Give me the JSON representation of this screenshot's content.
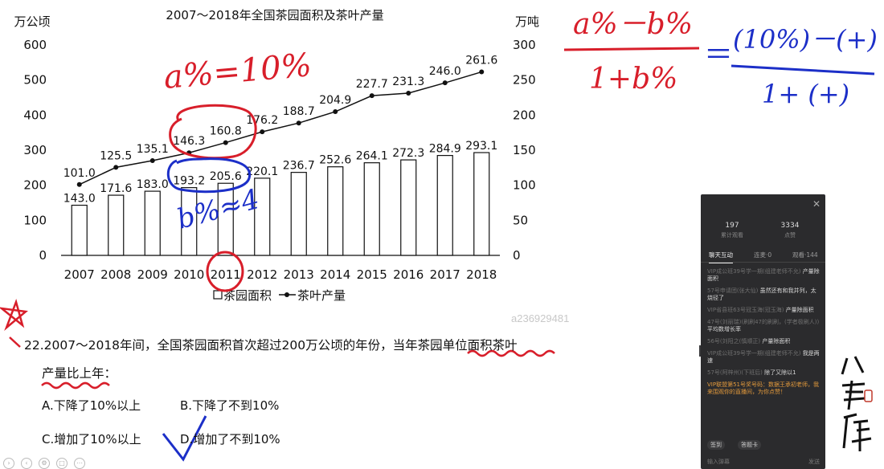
{
  "chart_data": {
    "type": "bar+line",
    "title": "2007～2018年全国茶园面积及茶叶产量",
    "ylabel_left": "万公顷",
    "ylabel_right": "万吨",
    "categories": [
      "2007",
      "2008",
      "2009",
      "2010",
      "2011",
      "2012",
      "2013",
      "2014",
      "2015",
      "2016",
      "2017",
      "2018"
    ],
    "series": [
      {
        "name": "茶园面积",
        "kind": "bar",
        "axis": "left",
        "values": [
          143.0,
          171.6,
          183.0,
          193.2,
          205.6,
          220.1,
          236.7,
          252.6,
          264.1,
          272.3,
          284.9,
          293.1
        ],
        "labels": [
          "143.0",
          "171.6",
          "183.0",
          "193.2",
          "205.6",
          "220.1",
          "236.7",
          "252.6",
          "264.1",
          "272.3",
          "284.9",
          "293.1"
        ]
      },
      {
        "name": "茶叶产量",
        "kind": "line",
        "axis": "right",
        "values": [
          101.0,
          125.5,
          135.1,
          146.3,
          160.8,
          176.2,
          188.7,
          204.9,
          227.7,
          231.3,
          246.0,
          261.6
        ],
        "labels": [
          "101.0",
          "125.5",
          "135.1",
          "146.3",
          "160.8",
          "176.2",
          "188.7",
          "204.9",
          "227.7",
          "231.3",
          "246.0",
          "261.6"
        ]
      }
    ],
    "ylim_left": [
      0,
      600
    ],
    "yticks_left": [
      "0",
      "100",
      "200",
      "300",
      "400",
      "500",
      "600"
    ],
    "ylim_right": [
      0,
      300
    ],
    "yticks_right": [
      "0",
      "50",
      "100",
      "150",
      "200",
      "250",
      "300"
    ],
    "legend": [
      "茶园面积",
      "茶叶产量"
    ],
    "legend_position": "bottom",
    "grid": false
  },
  "annotations": {
    "a_eq": "a%=10%",
    "b_eq": "b%≈4",
    "formula_top": "a%－b%",
    "formula_bottom": "1+b%",
    "formula_eq": "＝",
    "formula_right_top": "(10%)－(+)",
    "formula_right_bottom": "1+ (+)",
    "pen_color_red": "#d81e2a",
    "pen_color_blue": "#1c2fc8"
  },
  "question": {
    "stem_part1": "22.2007～2018年间，全国茶园面积首次超过200万公顷的年份，当年茶园",
    "stem_underlined": "单位面积茶叶",
    "stem_part2": "产量比上年",
    "stem_colon": "：",
    "options": [
      {
        "key": "A",
        "text": "A.下降了10%以上"
      },
      {
        "key": "B",
        "text": "B.下降了不到10%"
      },
      {
        "key": "C",
        "text": "C.增加了10%以上"
      },
      {
        "key": "D",
        "text": "D.增加了不到10%"
      }
    ]
  },
  "watermark": "a236929481",
  "panel": {
    "stats": [
      {
        "num": "197",
        "label": "累计观看"
      },
      {
        "num": "3334",
        "label": "点赞"
      }
    ],
    "tabs": [
      {
        "label": "聊天互动",
        "active": true
      },
      {
        "label": "连麦·0",
        "active": false
      },
      {
        "label": "观看·144",
        "active": false
      }
    ],
    "messages": [
      {
        "user": "VIP成公班39号学一期(组建老师不允)",
        "text": "产量除面积",
        "vip": false
      },
      {
        "user": "57号申请团(张大仙)",
        "text": "虽然还有和我并列，太烧径了",
        "vip": false
      },
      {
        "user": "VIP省县班63号冠玉海(冠玉海)",
        "text": "产量除面积",
        "vip": false
      },
      {
        "user": "47号(刘丽瑞)(刷刷47的刷刷，(学者极刷人))",
        "text": "平均数增长率",
        "vip": false
      },
      {
        "user": "56号(刘阳之(慎顺正)",
        "text": "产量除面积",
        "vip": false
      },
      {
        "user": "VIP成公班39号学一期(组建老师不允)",
        "text": "我是两速",
        "vip": false
      },
      {
        "user": "57号(阿梓州)(下班后)",
        "text": "除了又除以1",
        "vip": false
      },
      {
        "user": "",
        "text": "VIP联盟第51号奖号码：数据王承初老师，我来围观你的直播间，为你点赞！",
        "vip": true
      }
    ],
    "actions": [
      "签到",
      "答题卡"
    ],
    "input_placeholder": "输入弹幕",
    "send_label": "发送"
  }
}
